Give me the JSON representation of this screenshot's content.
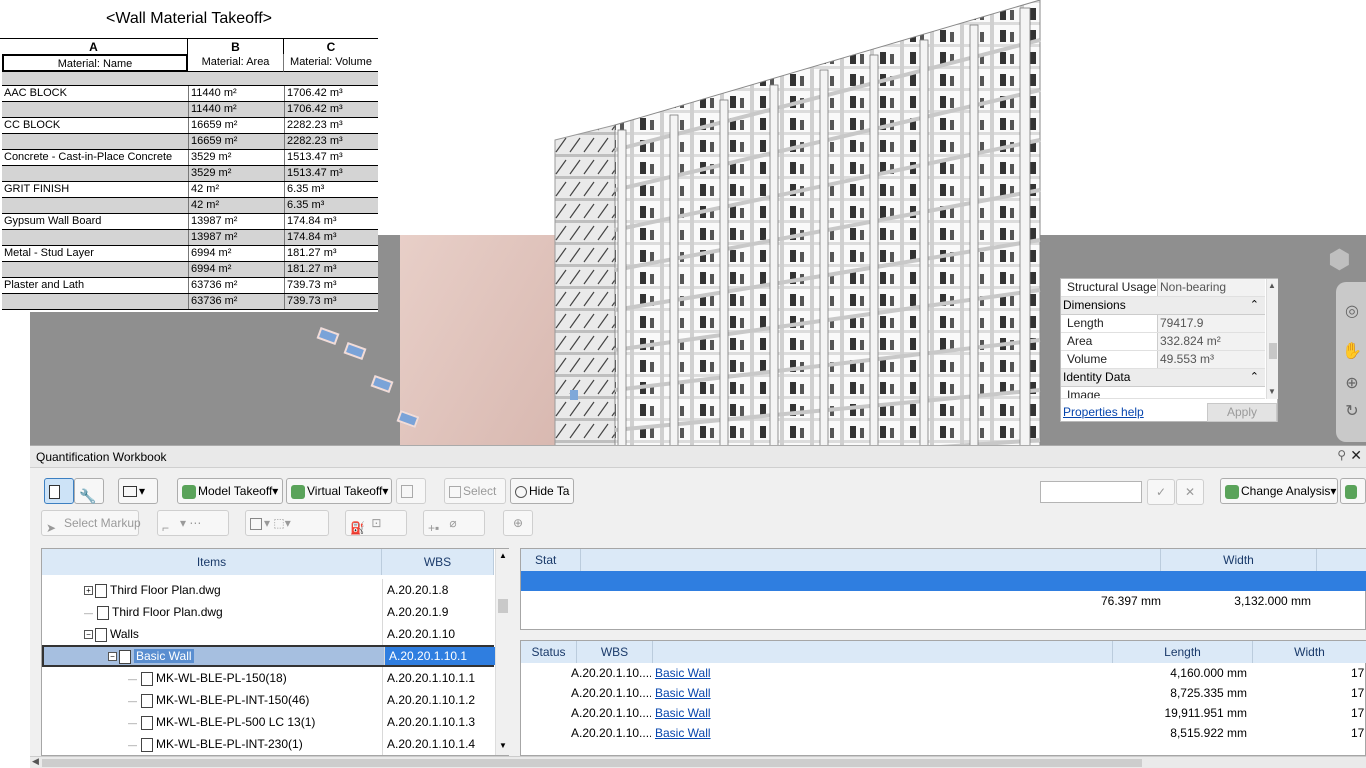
{
  "schedule": {
    "title": "<Wall Material Takeoff>",
    "column_letters": [
      "A",
      "B",
      "C"
    ],
    "headers": [
      "Material: Name",
      "Material: Area",
      "Material: Volume"
    ],
    "rows": [
      {
        "name": "AAC BLOCK",
        "area": "11440 m²",
        "volume": "1706.42 m³"
      },
      {
        "name": "",
        "area": "11440 m²",
        "volume": "1706.42 m³"
      },
      {
        "name": "CC BLOCK",
        "area": "16659 m²",
        "volume": "2282.23 m³"
      },
      {
        "name": "",
        "area": "16659 m²",
        "volume": "2282.23 m³"
      },
      {
        "name": "Concrete - Cast-in-Place Concrete",
        "area": "3529 m²",
        "volume": "1513.47 m³"
      },
      {
        "name": "",
        "area": "3529 m²",
        "volume": "1513.47 m³"
      },
      {
        "name": "GRIT FINISH",
        "area": "42 m²",
        "volume": "6.35 m³"
      },
      {
        "name": "",
        "area": "42 m²",
        "volume": "6.35 m³"
      },
      {
        "name": "Gypsum Wall Board",
        "area": "13987 m²",
        "volume": "174.84 m³"
      },
      {
        "name": "",
        "area": "13987 m²",
        "volume": "174.84 m³"
      },
      {
        "name": "Metal - Stud Layer",
        "area": "6994 m²",
        "volume": "181.27 m³"
      },
      {
        "name": "",
        "area": "6994 m²",
        "volume": "181.27 m³"
      },
      {
        "name": "Plaster and Lath",
        "area": "63736 m²",
        "volume": "739.73 m³"
      },
      {
        "name": "",
        "area": "63736 m²",
        "volume": "739.73 m³"
      }
    ]
  },
  "properties": {
    "structural_usage_label": "Structural Usage",
    "structural_usage_value": "Non-bearing",
    "dimensions_group": "Dimensions",
    "length_label": "Length",
    "length_value": "79417.9",
    "area_label": "Area",
    "area_value": "332.824 m²",
    "volume_label": "Volume",
    "volume_value": "49.553 m³",
    "identity_group": "Identity Data",
    "image_label": "Image",
    "help_link": "Properties help",
    "apply_label": "Apply"
  },
  "workbook": {
    "title": "Quantification Workbook",
    "toolbar": {
      "model_takeoff": "Model Takeoff",
      "virtual_takeoff": "Virtual Takeoff",
      "select": "Select",
      "hide_ta": "Hide Ta",
      "change_analysis": "Change Analysis",
      "select_markup": "Select Markup"
    },
    "items_headers": {
      "items": "Items",
      "wbs": "WBS"
    },
    "items": [
      {
        "name": "Third Floor Plan.dwg",
        "wbs": "A.20.20.1.8",
        "indent": 1,
        "toggle": "+"
      },
      {
        "name": "Third Floor Plan.dwg",
        "wbs": "A.20.20.1.9",
        "indent": 1,
        "toggle": ""
      },
      {
        "name": "Walls",
        "wbs": "A.20.20.1.10",
        "indent": 1,
        "toggle": "−"
      },
      {
        "name": "Basic Wall",
        "wbs": "A.20.20.1.10.1",
        "indent": 2,
        "toggle": "−",
        "selected": true
      },
      {
        "name": "MK-WL-BLE-PL-150(18)",
        "wbs": "A.20.20.1.10.1.1",
        "indent": 3,
        "toggle": ""
      },
      {
        "name": "MK-WL-BLE-PL-INT-150(46)",
        "wbs": "A.20.20.1.10.1.2",
        "indent": 3,
        "toggle": ""
      },
      {
        "name": "MK-WL-BLE-PL-500 LC 13(1)",
        "wbs": "A.20.20.1.10.1.3",
        "indent": 3,
        "toggle": ""
      },
      {
        "name": "MK-WL-BLE-PL-INT-230(1)",
        "wbs": "A.20.20.1.10.1.4",
        "indent": 3,
        "toggle": ""
      }
    ],
    "summary_grid": {
      "status_header": "Stat",
      "width_header": "Width",
      "length_value": "76.397 mm",
      "width_value": "3,132.000 mm"
    },
    "detail_grid": {
      "headers": {
        "status": "Status",
        "wbs": "WBS",
        "length": "Length",
        "width": "Width"
      },
      "rows": [
        {
          "wbs": "A.20.20.1.10....",
          "object": "Basic Wall",
          "length": "4,160.000 mm",
          "width": "17"
        },
        {
          "wbs": "A.20.20.1.10....",
          "object": "Basic Wall",
          "length": "8,725.335 mm",
          "width": "17"
        },
        {
          "wbs": "A.20.20.1.10....",
          "object": "Basic Wall",
          "length": "19,911.951 mm",
          "width": "17"
        },
        {
          "wbs": "A.20.20.1.10....",
          "object": "Basic Wall",
          "length": "8,515.922 mm",
          "width": "17"
        }
      ]
    }
  },
  "colors": {
    "selection_blue": "#2f7ee0",
    "header_blue": "#dbe9f7",
    "slab_pink": "#d9bcb4",
    "viewport_gray": "#8f8f8f"
  }
}
